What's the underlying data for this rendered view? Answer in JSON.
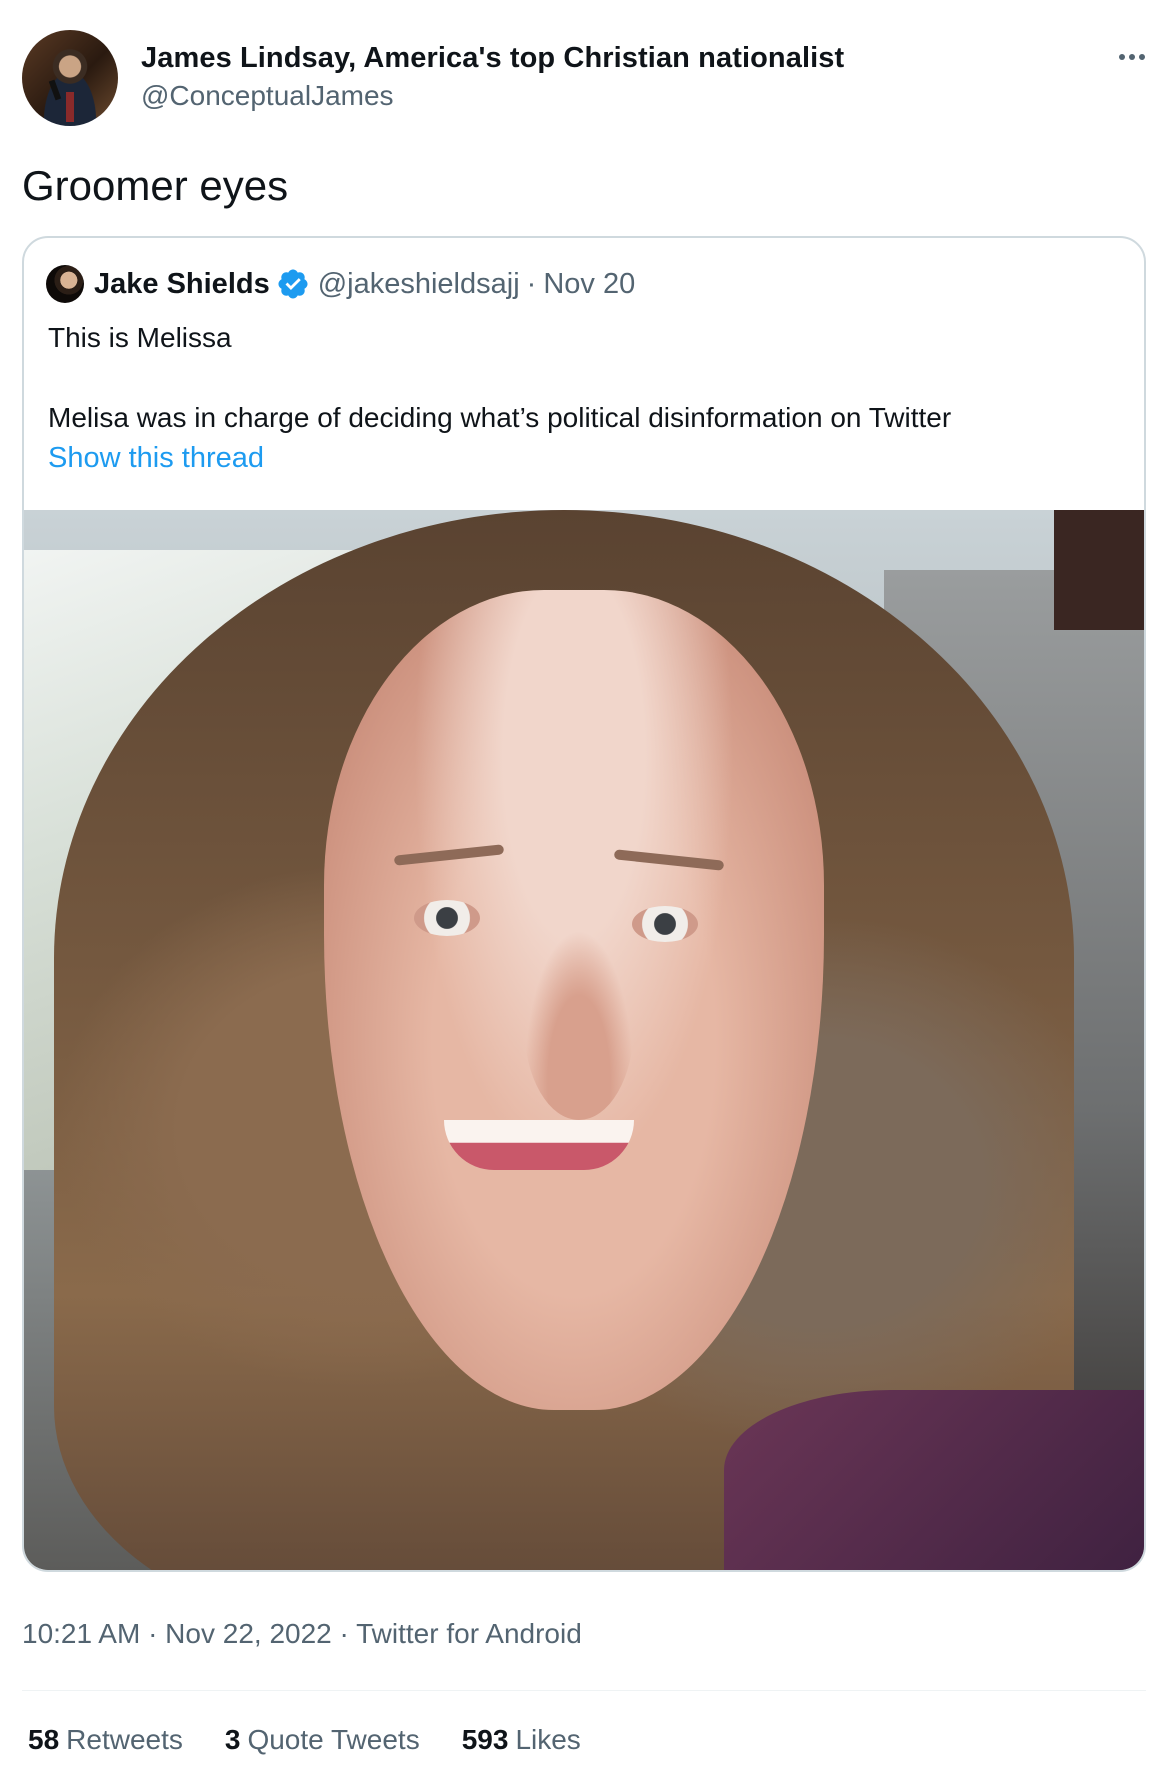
{
  "author": {
    "display_name": "James Lindsay, America's top Christian nationalist",
    "handle": "@ConceptualJames"
  },
  "tweet": {
    "text": "Groomer eyes",
    "timestamp_line": "10:21 AM · Nov 22, 2022 · Twitter for Android"
  },
  "quoted_tweet": {
    "display_name": "Jake Shields",
    "verified": true,
    "handle": "@jakeshieldsajj",
    "separator": "·",
    "date": "Nov 20",
    "line1": "This is Melissa",
    "line2": "Melisa was in charge of deciding what’s political disinformation on Twitter",
    "show_thread": "Show this thread"
  },
  "stats": [
    {
      "count": "58",
      "label": "Retweets"
    },
    {
      "count": "3",
      "label": "Quote Tweets"
    },
    {
      "count": "593",
      "label": "Likes"
    }
  ],
  "colors": {
    "link": "#1d9bf0",
    "secondary_text": "#536471",
    "verified_badge": "#1d9bf0"
  },
  "icons": [
    "more-icon",
    "verified-icon"
  ]
}
